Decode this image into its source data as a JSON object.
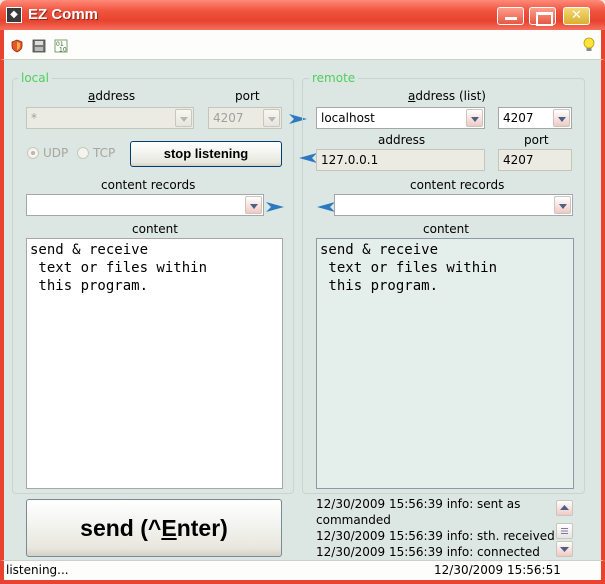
{
  "window": {
    "title": "EZ Comm",
    "close_glyph": "✕"
  },
  "icons": [
    "shield-icon",
    "save-icon",
    "encoding-icon",
    "lightbulb-icon"
  ],
  "local": {
    "legend": "local",
    "address_label": "address",
    "address_value": "*",
    "port_label": "port",
    "port_value": "4207",
    "udp_label": "UDP",
    "tcp_label": "TCP",
    "protocol_selected": "UDP",
    "stop_button": "stop listening",
    "records_label": "content records",
    "records_value": "",
    "content_label": "content",
    "content_text": "send & receive\n text or files within\n this program."
  },
  "remote": {
    "legend": "remote",
    "address_list_label": "address (list)",
    "address_list_value": "localhost",
    "port_list_value": "4207",
    "address_label": "address",
    "address_value": "127.0.0.1",
    "port_label": "port",
    "port_value": "4207",
    "records_label": "content records",
    "records_value": "",
    "content_label": "content",
    "content_text": "send & receive\n text or files within\n this program."
  },
  "send": {
    "label_prefix": "send (^",
    "label_key": "E",
    "label_suffix": "nter)"
  },
  "log": [
    "12/30/2009 15:56:39 info: sent as",
    "commanded",
    "12/30/2009 15:56:39 info: sth. received",
    "12/30/2009 15:56:39 info: connected"
  ],
  "status": {
    "left": "listening...",
    "right": "12/30/2009 15:56:51"
  },
  "colors": {
    "title_bar": "#e7432f",
    "panel_bg": "#dce6e2",
    "legend": "#4fcf5a"
  }
}
